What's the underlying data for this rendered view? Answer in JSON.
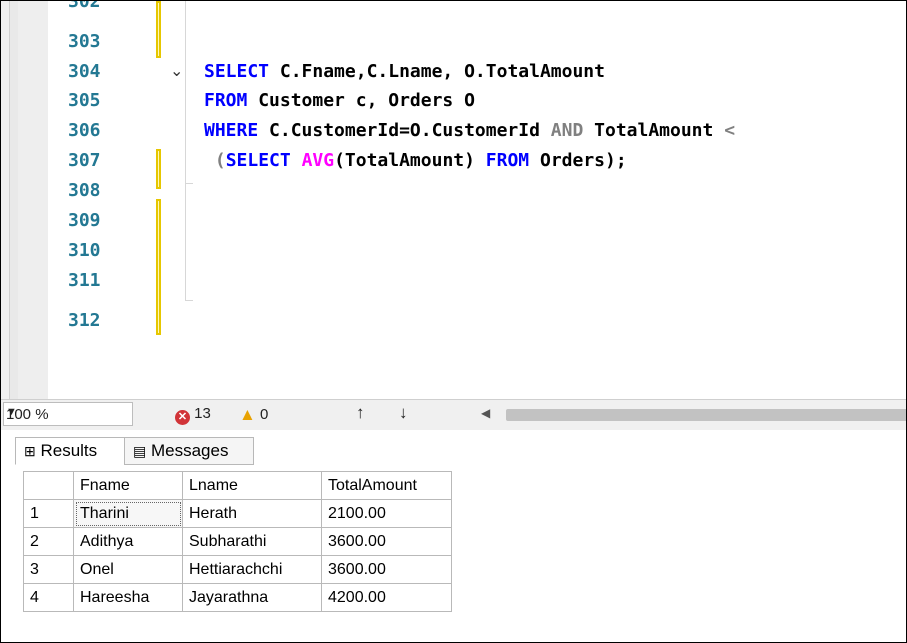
{
  "editor": {
    "lines": [
      {
        "num": "302"
      },
      {
        "num": "303"
      },
      {
        "num": "304"
      },
      {
        "num": "305"
      },
      {
        "num": "306"
      },
      {
        "num": "307"
      },
      {
        "num": "308"
      },
      {
        "num": "309"
      },
      {
        "num": "310"
      },
      {
        "num": "311"
      },
      {
        "num": "312"
      }
    ],
    "code": {
      "l304_kw1": "SELECT",
      "l304_rest": " C.Fname,C.Lname, O.TotalAmount",
      "l305_kw1": "FROM",
      "l305_rest": " Customer c, Orders O",
      "l306_kw1": "WHERE",
      "l306_mid": " C.CustomerId=O.CustomerId ",
      "l306_kw2": "AND",
      "l306_rest": " TotalAmount ",
      "l306_op": "<",
      "l307_open": " (",
      "l307_kw1": "SELECT",
      "l307_sp": " ",
      "l307_fn": "AVG",
      "l307_arg": "(TotalAmount) ",
      "l307_kw2": "FROM",
      "l307_rest": " Orders);"
    }
  },
  "statusbar": {
    "zoom": "100 %",
    "error_count": "13",
    "warning_count": "0"
  },
  "results": {
    "tabs": [
      {
        "label": "Results",
        "icon": "grid-icon"
      },
      {
        "label": "Messages",
        "icon": "messages-icon"
      }
    ],
    "columns": [
      "Fname",
      "Lname",
      "TotalAmount"
    ],
    "rows": [
      {
        "n": "1",
        "fname": "Tharini",
        "lname": "Herath",
        "total": "2100.00"
      },
      {
        "n": "2",
        "fname": "Adithya",
        "lname": "Subharathi",
        "total": "3600.00"
      },
      {
        "n": "3",
        "fname": "Onel",
        "lname": "Hettiarachchi",
        "total": "3600.00"
      },
      {
        "n": "4",
        "fname": "Hareesha",
        "lname": "Jayarathna",
        "total": "4200.00"
      }
    ]
  },
  "colors": {
    "keyword": "#0000ff",
    "function": "#ff00ff",
    "line_number": "#237893",
    "error": "#d13438",
    "warning": "#e8a202"
  }
}
